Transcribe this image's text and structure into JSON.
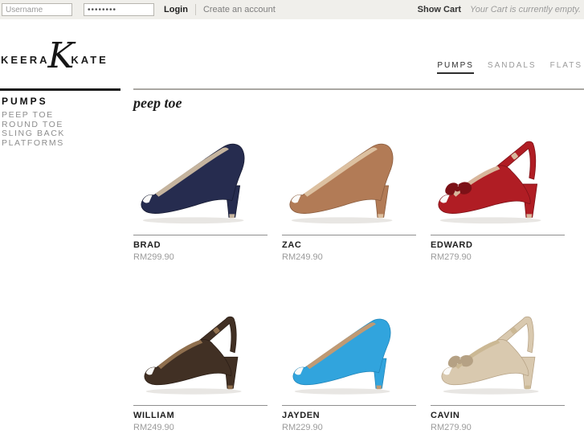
{
  "topbar": {
    "username_placeholder": "Username",
    "password_mask": "••••••••",
    "login_label": "Login",
    "create_account_label": "Create an account",
    "show_cart_label": "Show Cart",
    "cart_status": "Your Cart is currently empty."
  },
  "brand": {
    "word_left": "KEERA",
    "monogram": "K",
    "word_right": "KATE"
  },
  "nav": {
    "items": [
      {
        "label": "PUMPS",
        "active": true
      },
      {
        "label": "SANDALS",
        "active": false
      },
      {
        "label": "FLATS",
        "active": false
      }
    ]
  },
  "sidebar": {
    "title": "PUMPS",
    "items": [
      "PEEP TOE",
      "ROUND TOE",
      "SLING BACK",
      "PLATFORMS"
    ]
  },
  "main": {
    "heading": "peep toe"
  },
  "products": [
    {
      "name": "BRAD",
      "price": "RM299.90",
      "style": "pump",
      "bow": false,
      "colors": {
        "main": "#262c4f",
        "dark": "#171b33",
        "insole": "#c5b49e"
      }
    },
    {
      "name": "ZAC",
      "price": "RM249.90",
      "style": "pump",
      "bow": false,
      "colors": {
        "main": "#b27b56",
        "dark": "#8a5c3e",
        "insole": "#dcc0a0"
      }
    },
    {
      "name": "EDWARD",
      "price": "RM279.90",
      "style": "slingback",
      "bow": true,
      "colors": {
        "main": "#b01d24",
        "dark": "#7c1117",
        "insole": "#d8b79c"
      }
    },
    {
      "name": "WILLIAM",
      "price": "RM249.90",
      "style": "slingback",
      "bow": false,
      "colors": {
        "main": "#413024",
        "dark": "#2a1d15",
        "insole": "#8f6f4e"
      }
    },
    {
      "name": "JAYDEN",
      "price": "RM229.90",
      "style": "pump",
      "bow": false,
      "colors": {
        "main": "#31a4dd",
        "dark": "#1f84b8",
        "insole": "#c09a74"
      }
    },
    {
      "name": "CAVIN",
      "price": "RM279.90",
      "style": "slingback",
      "bow": true,
      "colors": {
        "main": "#d9c9af",
        "dark": "#b5a184",
        "insole": "#cbb894"
      }
    }
  ]
}
